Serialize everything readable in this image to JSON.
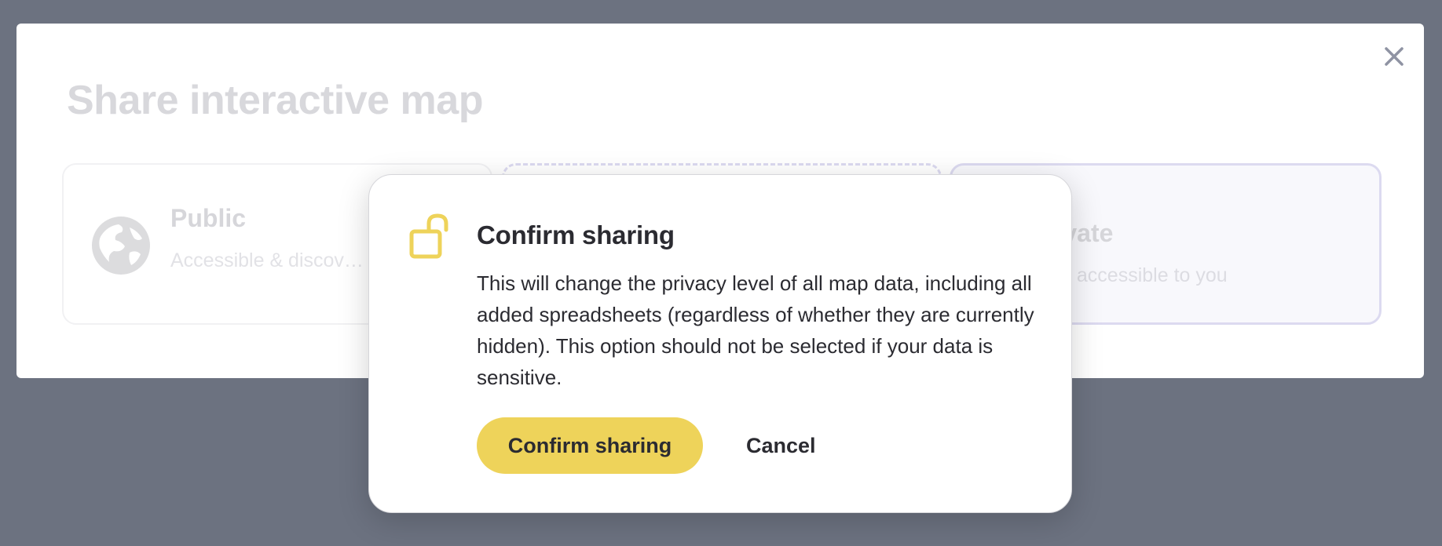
{
  "share_modal": {
    "title": "Share interactive map",
    "close_icon": "close-icon",
    "options": [
      {
        "id": "public",
        "icon": "globe-icon",
        "label": "Public",
        "description": "Accessible & discov… anyone"
      },
      {
        "id": "link",
        "label": "",
        "description": ""
      },
      {
        "id": "private",
        "label": "rivate",
        "description": "nly accessible to you"
      }
    ]
  },
  "confirm_dialog": {
    "icon": "unlocked-padlock-icon",
    "title": "Confirm sharing",
    "body": "This will change the privacy level of all map data, including all added spreadsheets (regardless of whether they are currently hidden). This option should not be selected if your data is sensitive.",
    "confirm_label": "Confirm sharing",
    "cancel_label": "Cancel"
  },
  "colors": {
    "backdrop": "#6c7280",
    "accent_yellow": "#eed35a",
    "text_dark": "#2b2b31",
    "faded_text": "#d8d8dc",
    "card_border_purple": "#dcdaf0"
  }
}
